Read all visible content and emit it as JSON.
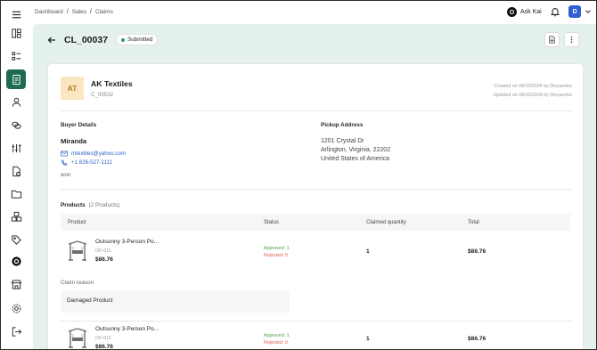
{
  "breadcrumb": [
    "Dashboard",
    "Sales",
    "Claims"
  ],
  "breadcrumb_sep": "/",
  "topbar": {
    "ask_label": "Ask Kai",
    "avatar_initial": "D"
  },
  "sidebar": {
    "items": [
      {
        "icon": "dashboard-icon"
      },
      {
        "icon": "list-icon"
      },
      {
        "icon": "document-icon",
        "active": true
      },
      {
        "icon": "user-icon"
      },
      {
        "icon": "coins-icon"
      },
      {
        "icon": "sliders-icon"
      },
      {
        "icon": "file-settings-icon"
      },
      {
        "icon": "folder-icon"
      },
      {
        "icon": "boxes-icon"
      },
      {
        "icon": "tag-icon"
      },
      {
        "icon": "kai-icon"
      },
      {
        "icon": "store-icon"
      },
      {
        "icon": "gear-icon"
      },
      {
        "icon": "logout-icon"
      }
    ]
  },
  "claim": {
    "id": "CL_00037",
    "status": "Submitted"
  },
  "company": {
    "initials": "AT",
    "name": "AK Textiles",
    "code": "C_00532",
    "created": "Created on 08/10/2026 by Divyanshu",
    "updated": "Updated on 08/10/2026 by Divyanshu"
  },
  "buyer": {
    "section_label": "Buyer Details",
    "name": "Miranda",
    "email": "mtextiles@yahoo.com",
    "phone": "+1 826-527-1111",
    "note": "won"
  },
  "pickup": {
    "section_label": "Pickup Address",
    "line1": "1201 Crystal Dr",
    "line2": "Arlington, Virginia, 22202",
    "line3": "United States of America"
  },
  "products": {
    "title": "Products",
    "count_label": "(2 Products)",
    "columns": [
      "Product",
      "Status",
      "Claimed quantity",
      "Total"
    ],
    "rows": [
      {
        "name": "Outsunny 3-Person Po...",
        "sku": "OF-011",
        "price": "$86.76",
        "approved": "Approved: 1",
        "rejected": "Rejected: 0",
        "qty": "1",
        "total": "$86.76"
      },
      {
        "name": "Outsunny 3-Person Po...",
        "sku": "OF-011",
        "price": "$86.76",
        "approved": "Approved: 1",
        "rejected": "Rejected: 0",
        "qty": "1",
        "total": "$86.76"
      }
    ]
  },
  "claim_reason": {
    "label": "Claim reason",
    "value": "Damaged Product"
  },
  "colors": {
    "accent": "#1f6b4f",
    "page_bg": "#e4f1ec",
    "link": "#2f63c9",
    "approved": "#55a04a",
    "rejected": "#e05a4d"
  }
}
